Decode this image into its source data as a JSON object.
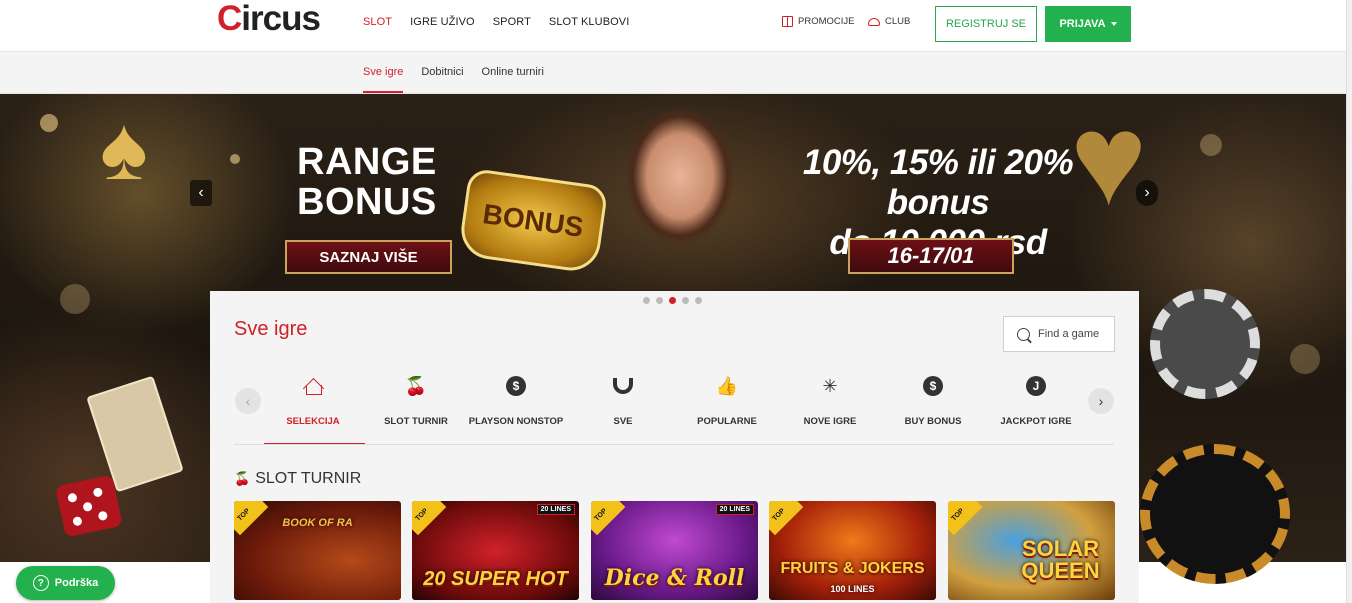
{
  "header": {
    "logo_text": "ircus",
    "logo_initial": "C",
    "nav": [
      "SLOT",
      "IGRE UŽIVO",
      "SPORT",
      "SLOT KLUBOVI"
    ],
    "promo_label": "PROMOCIJE",
    "club_label": "CLUB",
    "register_label": "REGISTRUJ SE",
    "login_label": "PRIJAVA"
  },
  "subnav": [
    "Sve igre",
    "Dobitnici",
    "Online turniri"
  ],
  "banner": {
    "headline_1": "RANGE",
    "headline_2": "BONUS",
    "cta": "SAZNAJ VIŠE",
    "slot_text": "BONUS",
    "offer_line_1": "10%, 15% ili 20% bonus",
    "offer_line_2": "do 10.000 rsd",
    "date": "16-17/01",
    "active_slide": 3,
    "slide_count": 5
  },
  "games_section": {
    "title": "Sve igre",
    "search_placeholder": "Find a game",
    "categories": [
      {
        "label": "SELEKCIJA",
        "icon": "home-icon"
      },
      {
        "label": "SLOT TURNIR",
        "icon": "cherries-icon"
      },
      {
        "label": "PLAYSON NONSTOP",
        "icon": "dollar-coin-icon"
      },
      {
        "label": "SVE",
        "icon": "magnet-icon"
      },
      {
        "label": "POPULARNE",
        "icon": "thumbs-up-icon"
      },
      {
        "label": "NOVE IGRE",
        "icon": "sparkle-icon"
      },
      {
        "label": "BUY BONUS",
        "icon": "dollar-coin-icon"
      },
      {
        "label": "JACKPOT IGRE",
        "icon": "jackpot-coin-icon"
      }
    ],
    "slot_turnir_title": "SLOT TURNIR",
    "games": [
      {
        "title": "BOOK OF RA",
        "badge": "TOP",
        "lines": ""
      },
      {
        "title": "20 SUPER HOT",
        "badge": "TOP",
        "lines": "20 LINES"
      },
      {
        "title": "Dice & Roll",
        "badge": "TOP",
        "lines": "20 LINES"
      },
      {
        "title": "FRUITS & JOKERS",
        "subtitle": "100 LINES",
        "badge": "TOP",
        "lines": ""
      },
      {
        "title": "SOLAR QUEEN",
        "badge": "TOP",
        "lines": ""
      }
    ]
  },
  "support_label": "Podrška"
}
